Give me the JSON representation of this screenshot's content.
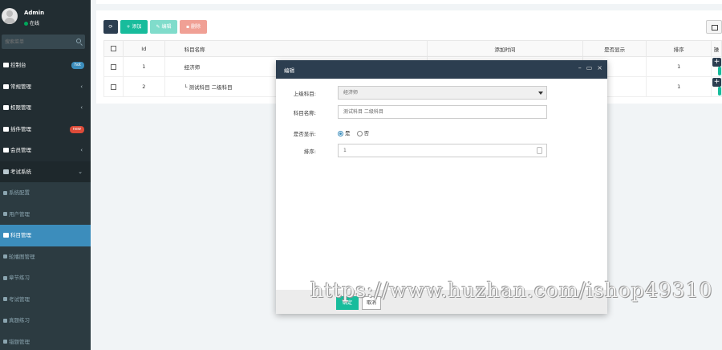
{
  "sidebar": {
    "user": {
      "name": "Admin",
      "status": "在线"
    },
    "search_placeholder": "搜索菜单",
    "items": [
      {
        "label": "控制台",
        "badge": "hot"
      },
      {
        "label": "常规管理"
      },
      {
        "label": "权限管理"
      },
      {
        "label": "插件管理",
        "badge": "new"
      },
      {
        "label": "会员管理"
      },
      {
        "label": "考试系统"
      },
      {
        "label": "系统配置"
      },
      {
        "label": "用户管理"
      },
      {
        "label": "科目管理"
      },
      {
        "label": "轮播图管理"
      },
      {
        "label": "章节练习"
      },
      {
        "label": "考试管理"
      },
      {
        "label": "真题练习"
      },
      {
        "label": "错题管理"
      }
    ]
  },
  "toolbar": {
    "add_label": "添加",
    "edit_label": "编辑",
    "delete_label": "删除"
  },
  "table": {
    "headers": [
      "Id",
      "科目名称",
      "添加时间",
      "是否显示",
      "排序",
      "操"
    ],
    "rows": [
      {
        "id": "1",
        "name": "经济师",
        "sort": "1"
      },
      {
        "id": "2",
        "name": "└ 测试科目 二级科目",
        "sort": "1"
      }
    ]
  },
  "modal": {
    "title": "编辑",
    "fields": {
      "parent_label": "上级科目:",
      "parent_value": "经济师",
      "name_label": "科目名称:",
      "name_value": "测试科目 二级科目",
      "show_label": "是否显示:",
      "show_yes": "是",
      "show_no": "否",
      "sort_label": "排序:",
      "sort_value": "1"
    },
    "ok_label": "确定",
    "cancel_label": "取消"
  },
  "watermark": "https://www.huzhan.com/ishop49310",
  "colors": {
    "sidebar_bg": "#222d32",
    "active": "#3c8dbc",
    "primary": "#18bc9c",
    "modal_header": "#2c3e50"
  }
}
